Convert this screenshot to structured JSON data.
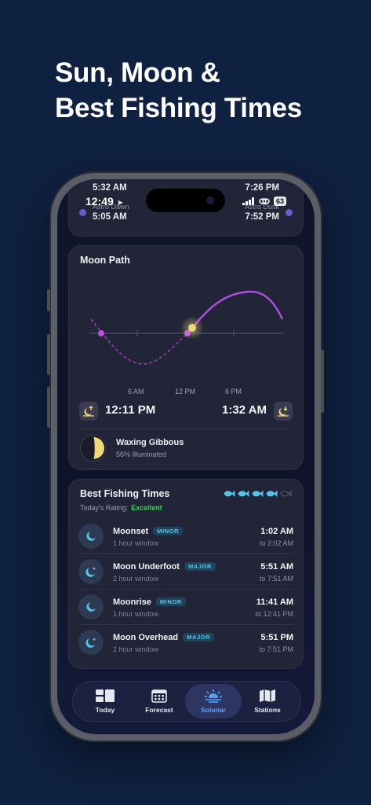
{
  "headline": {
    "line1": "Sun, Moon &",
    "line2": "Best Fishing Times"
  },
  "status_bar": {
    "time": "12:49",
    "battery": "63"
  },
  "top_card": {
    "left_top_time": "5:32 AM",
    "left_label": "Astro Dawn",
    "left_bottom_time": "5:05 AM",
    "right_top_time": "7:26 PM",
    "right_label": "Astro Dusk",
    "right_bottom_time": "7:52 PM"
  },
  "moon_path": {
    "title": "Moon Path",
    "axis_labels": [
      "6 AM",
      "12 PM",
      "6 PM"
    ],
    "moonrise_time": "12:11 PM",
    "moonset_time": "1:32 AM",
    "phase_name": "Waxing Gibbous",
    "illumination": "56% Illuminated",
    "illumination_fraction": 0.56
  },
  "fishing": {
    "title": "Best Fishing Times",
    "rating_label": "Today's Rating:",
    "rating_value": "Excellent",
    "rating_fish_filled": 4,
    "rating_fish_total": 5,
    "rows": [
      {
        "name": "Moonset",
        "tag": "MINOR",
        "window": "1 hour window",
        "time": "1:02 AM",
        "to": "to 2:02 AM",
        "icon": "moon-icon"
      },
      {
        "name": "Moon Underfoot",
        "tag": "MAJOR",
        "window": "2 hour window",
        "time": "5:51 AM",
        "to": "to 7:51 AM",
        "icon": "moon-star-icon"
      },
      {
        "name": "Moonrise",
        "tag": "MINOR",
        "window": "1 hour window",
        "time": "11:41 AM",
        "to": "to 12:41 PM",
        "icon": "moon-icon"
      },
      {
        "name": "Moon Overhead",
        "tag": "MAJOR",
        "window": "2 hour window",
        "time": "5:51 PM",
        "to": "to 7:51 PM",
        "icon": "moon-star-icon"
      }
    ]
  },
  "tabs": [
    {
      "label": "Today",
      "active": false
    },
    {
      "label": "Forecast",
      "active": false
    },
    {
      "label": "Solunar",
      "active": true
    },
    {
      "label": "Stations",
      "active": false
    }
  ],
  "colors": {
    "background": "#0f2140",
    "accent_cyan": "#4fc7e8",
    "accent_purple": "#b04ee0",
    "moon_yellow": "#f0d878",
    "rating_green": "#3ccf5a",
    "active_tab": "#4fa6ff"
  }
}
